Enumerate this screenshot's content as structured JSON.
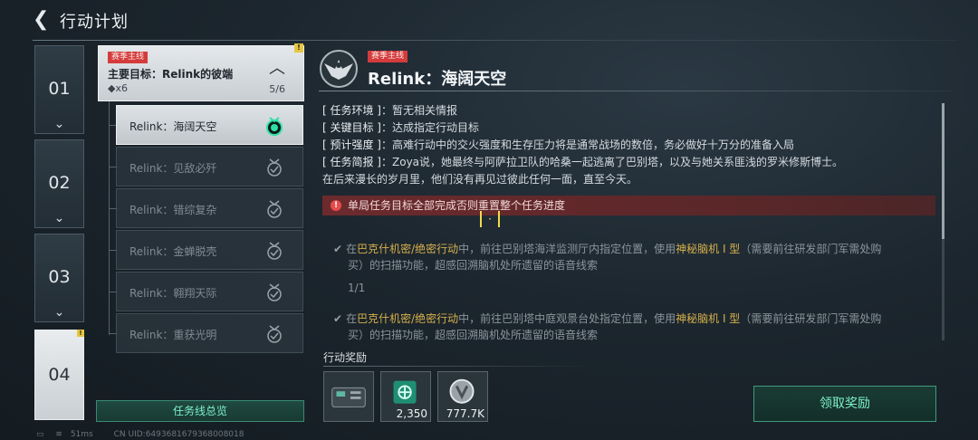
{
  "header": {
    "back_icon": "back-arrow-icon",
    "title": "行动计划"
  },
  "chapters": [
    {
      "num": "01",
      "active": false
    },
    {
      "num": "02",
      "active": false
    },
    {
      "num": "03",
      "active": false
    },
    {
      "num": "04",
      "active": true
    }
  ],
  "mission": {
    "tag": "赛季主线",
    "goal": "主要目标：Relink的彼端",
    "reward_count": "◆x6",
    "progress": "5/6"
  },
  "tasks": [
    {
      "label": "Relink：海阔天空",
      "active": true
    },
    {
      "label": "Relink：见敌必歼",
      "active": false
    },
    {
      "label": "Relink：错综复杂",
      "active": false
    },
    {
      "label": "Relink：金蝉脱壳",
      "active": false
    },
    {
      "label": "Relink：翱翔天际",
      "active": false
    },
    {
      "label": "Relink：重获光明",
      "active": false
    }
  ],
  "overview_button": "任务线总览",
  "detail": {
    "tag": "赛季主线",
    "title": "Relink：海阔天空",
    "info": [
      {
        "key": "[ 任务环境 ]",
        "value": "：暂无相关情报"
      },
      {
        "key": "[ 关键目标 ]",
        "value": "：达成指定行动目标"
      },
      {
        "key": "[ 预计强度 ]",
        "value": "：高难行动中的交火强度和生存压力将是通常战场的数倍，务必做好十万分的准备入局"
      },
      {
        "key": "[ 任务简报 ]",
        "value": "：Zoya说，她最终与阿萨拉卫队的哈桑一起逃离了巴别塔，以及与她关系匪浅的罗米修斯博士。"
      },
      {
        "key": "",
        "value": "在后来漫长的岁月里，他们没有再见过彼此任何一面，直至今天。"
      }
    ],
    "warning": "单局任务目标全部完成否则重置整个任务进度",
    "objective1": {
      "pre": "在",
      "location": "巴克什机密/绝密行动",
      "mid": "中，前往巴别塔海洋监测厅内指定位置，使用",
      "item": "神秘脑机 I 型",
      "post": "（需要前往研发部门军需处购",
      "line2": "买）的扫描功能，超感回溯脑机处所遗留的语音线索",
      "count": "1/1"
    },
    "objective2": {
      "pre": "在",
      "location": "巴克什机密/绝密行动",
      "mid": "中，前往巴别塔中庭观景台处指定位置，使用",
      "item": "神秘脑机 I 型",
      "post": "（需要前往研发部门军需处购",
      "line2": "买）的扫描功能，超感回溯脑机处所遗留的语音线索"
    }
  },
  "rewards": {
    "title": "行动奖励",
    "items": [
      {
        "icon": "supply-crate-icon",
        "qty": ""
      },
      {
        "icon": "green-token-icon",
        "qty": "2,350"
      },
      {
        "icon": "silver-coin-icon",
        "qty": "777.7K"
      }
    ]
  },
  "claim_button": "领取奖励",
  "footer": {
    "ping": "51ms",
    "uid": "CN UID:6493681679368008018"
  },
  "colors": {
    "accent_green": "#7cf2c7",
    "warning_red": "#d43c3c",
    "highlight_gold": "#d6b04c"
  }
}
